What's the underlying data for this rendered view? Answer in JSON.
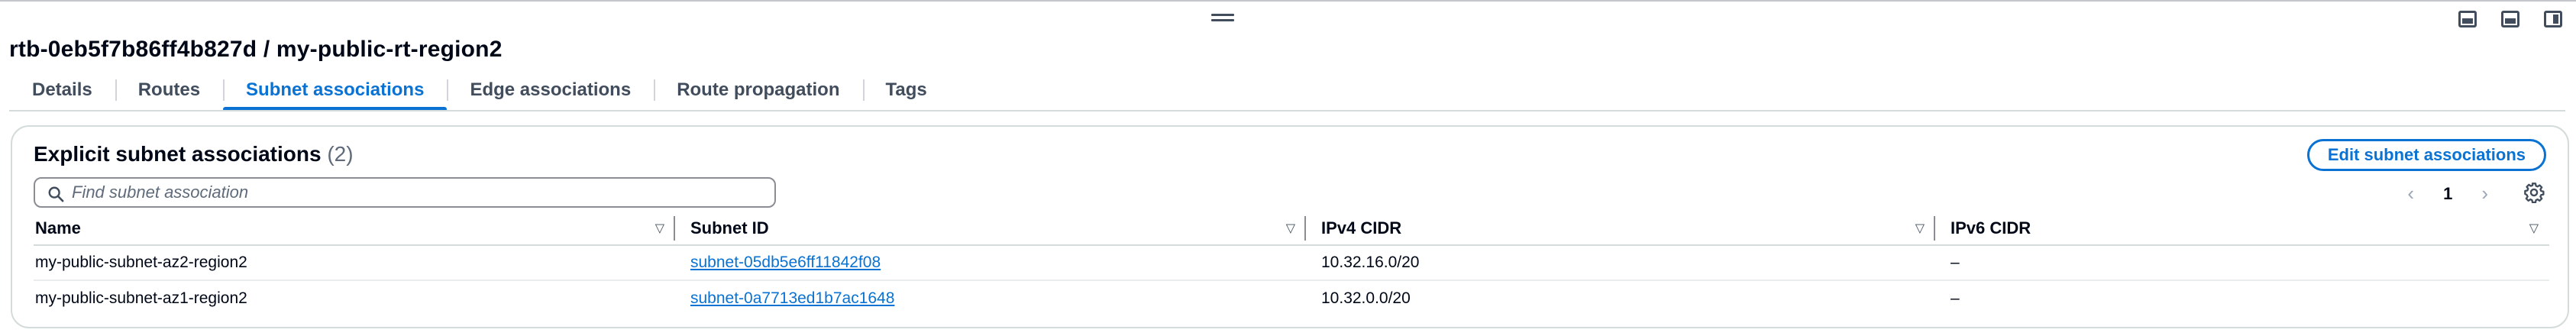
{
  "window": {
    "title": "rtb-0eb5f7b86ff4b827d / my-public-rt-region2",
    "layout_icons": [
      "panel-bottom-icon",
      "panel-split-icon",
      "panel-side-icon"
    ]
  },
  "tabs": [
    {
      "label": "Details",
      "active": false
    },
    {
      "label": "Routes",
      "active": false
    },
    {
      "label": "Subnet associations",
      "active": true
    },
    {
      "label": "Edge associations",
      "active": false
    },
    {
      "label": "Route propagation",
      "active": false
    },
    {
      "label": "Tags",
      "active": false
    }
  ],
  "panel": {
    "title": "Explicit subnet associations",
    "count": "(2)",
    "edit_button": "Edit subnet associations",
    "search_placeholder": "Find subnet association",
    "pagination": {
      "page": "1",
      "prev_icon": "chevron-left-icon",
      "next_icon": "chevron-right-icon"
    },
    "settings_icon": "gear-icon"
  },
  "table": {
    "columns": [
      "Name",
      "Subnet ID",
      "IPv4 CIDR",
      "IPv6 CIDR"
    ],
    "rows": [
      {
        "name": "my-public-subnet-az2-region2",
        "subnet_id": "subnet-05db5e6ff11842f08",
        "ipv4": "10.32.16.0/20",
        "ipv6": "–"
      },
      {
        "name": "my-public-subnet-az1-region2",
        "subnet_id": "subnet-0a7713ed1b7ac1648",
        "ipv4": "10.32.0.0/20",
        "ipv6": "–"
      }
    ]
  },
  "colors": {
    "accent": "#0972d3",
    "text": "#000716",
    "border": "#d5dbdb"
  }
}
